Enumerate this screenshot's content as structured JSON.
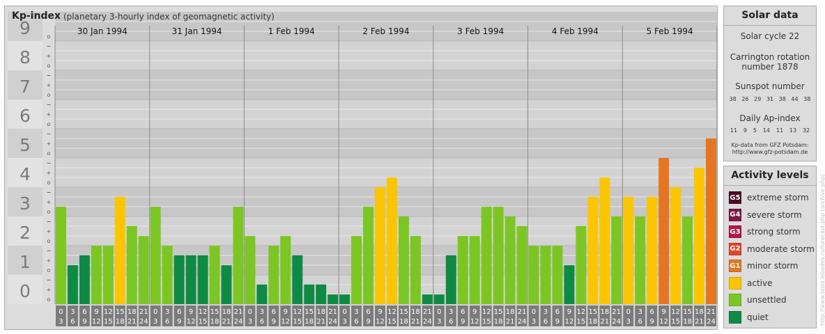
{
  "header": {
    "title": "Kp-index",
    "subtitle": "(planetary 3-hourly index of geomagnetic activity)"
  },
  "chart_data": {
    "type": "bar",
    "title": "Kp-index",
    "subtitle": "(planetary 3-hourly index of geomagnetic activity)",
    "ylim": [
      0,
      9
    ],
    "y_ticks": [
      "0",
      "1",
      "2",
      "3",
      "4",
      "5",
      "6",
      "7",
      "8",
      "9"
    ],
    "y_minor_ticks": [
      "o",
      "+",
      "−"
    ],
    "days": [
      "30 Jan 1994",
      "31 Jan 1994",
      "1 Feb 1994",
      "2 Feb 1994",
      "3 Feb 1994",
      "4 Feb 1994",
      "5 Feb 1994"
    ],
    "interval_tops": [
      "0",
      "3",
      "6",
      "9",
      "12",
      "15",
      "18",
      "21"
    ],
    "interval_bottoms": [
      "3",
      "6",
      "9",
      "12",
      "15",
      "18",
      "21",
      "24"
    ],
    "values": [
      [
        3.33,
        1.33,
        1.67,
        2.0,
        2.0,
        3.67,
        2.67,
        2.33
      ],
      [
        3.33,
        2.0,
        1.67,
        1.67,
        1.67,
        2.0,
        1.33,
        3.33
      ],
      [
        2.33,
        0.67,
        2.0,
        2.33,
        1.67,
        0.67,
        0.67,
        0.33
      ],
      [
        0.33,
        2.33,
        3.33,
        4.0,
        4.33,
        3.0,
        2.33,
        0.33
      ],
      [
        0.33,
        1.67,
        2.33,
        2.33,
        3.33,
        3.33,
        3.0,
        2.67
      ],
      [
        2.0,
        2.0,
        2.0,
        1.33,
        2.67,
        3.67,
        4.33,
        3.0
      ],
      [
        3.67,
        3.0,
        3.67,
        5.0,
        4.0,
        3.0,
        4.67,
        5.67
      ]
    ],
    "grid": true,
    "legend": "right"
  },
  "solar": {
    "title": "Solar data",
    "cycle": "Solar cycle 22",
    "carrington_line1": "Carrington rotation",
    "carrington_line2": "number 1878",
    "sunspot_title": "Sunspot number",
    "sunspots": [
      "38",
      "26",
      "29",
      "31",
      "38",
      "44",
      "38"
    ],
    "ap_title": "Daily Ap-index",
    "ap": [
      "11",
      "9",
      "5",
      "14",
      "11",
      "13",
      "32"
    ],
    "credit_line1": "Kp-data from GFZ Potsdam:",
    "credit_line2": "http://www.gfz-potsdam.de"
  },
  "activity": {
    "title": "Activity levels",
    "levels": [
      {
        "code": "G5",
        "label": "extreme storm",
        "color": "#4a0a24"
      },
      {
        "code": "G4",
        "label": "severe storm",
        "color": "#7e1846"
      },
      {
        "code": "G3",
        "label": "strong storm",
        "color": "#b3144c"
      },
      {
        "code": "G2",
        "label": "moderate storm",
        "color": "#e0452a"
      },
      {
        "code": "G1",
        "label": "minor storm",
        "color": "#e57621"
      },
      {
        "code": "",
        "label": "active",
        "color": "#fbc500"
      },
      {
        "code": "",
        "label": "unsettled",
        "color": "#7bc623"
      },
      {
        "code": "",
        "label": "quiet",
        "color": "#0f8a44"
      }
    ]
  },
  "watermark": "http://www.tesis.lebedev.ru/forecast.php (archive.php)"
}
